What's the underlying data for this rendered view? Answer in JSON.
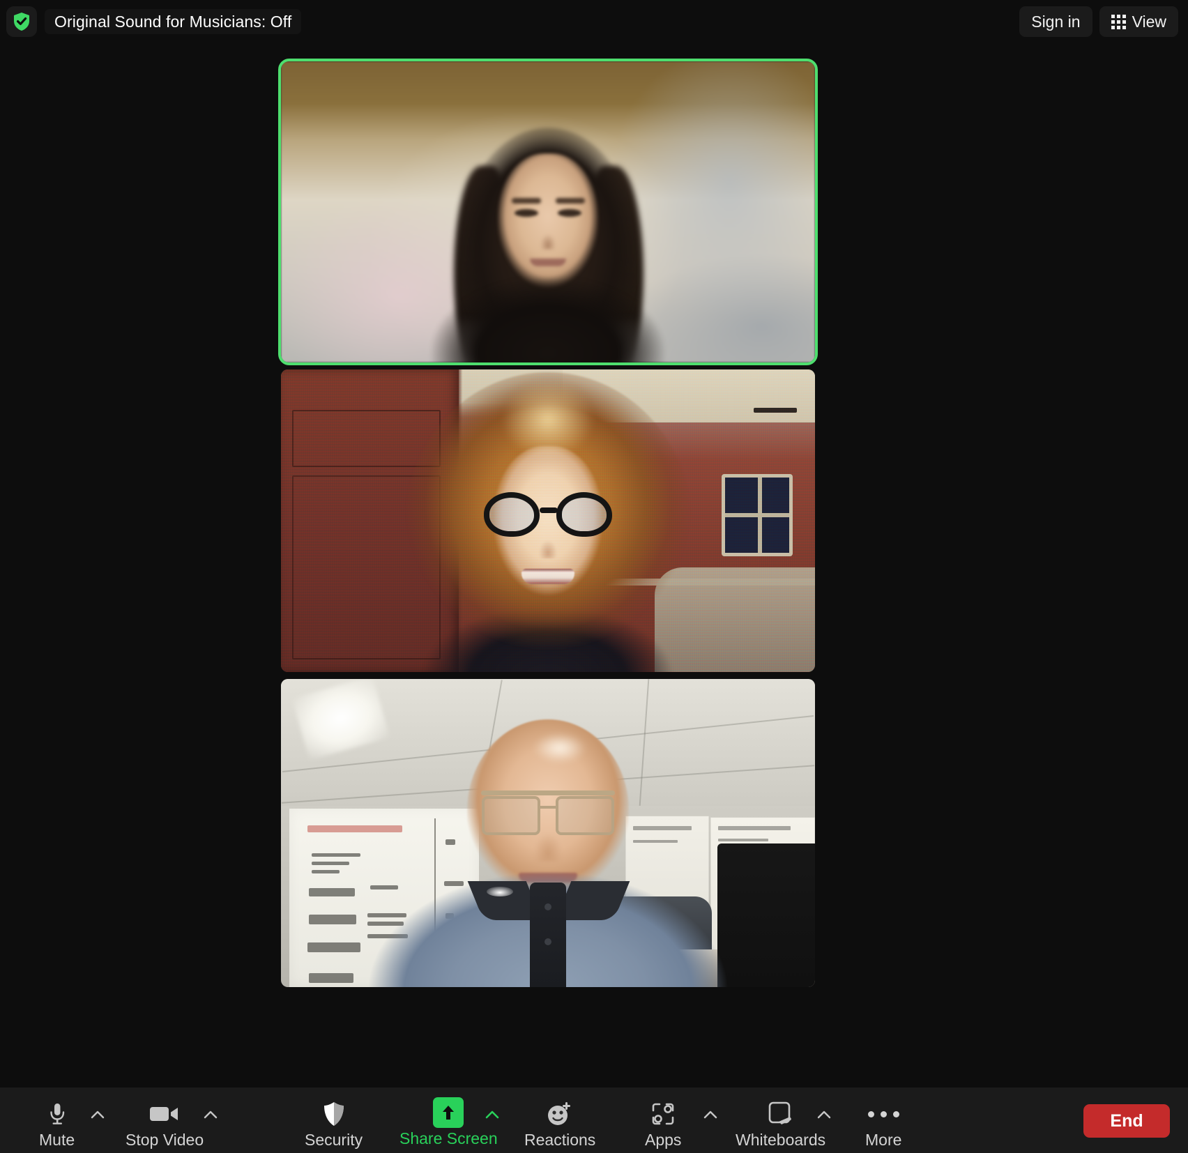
{
  "window": {
    "app": "Zoom Meeting",
    "background_color": "#0d0d0d",
    "toolbar_color": "#1b1b1b"
  },
  "topbar": {
    "security_badge_icon": "shield-check-icon",
    "security_badge_color": "#3fd964",
    "original_sound_label": "Original Sound for Musicians: Off",
    "sign_in_label": "Sign in",
    "view_label": "View",
    "view_icon": "grid-icon"
  },
  "stage": {
    "layout": "speaker-strip",
    "active_speaker_border_color": "#4ede6e",
    "participants": [
      {
        "index": 1,
        "tile_name": "participant-tile-1",
        "active_speaker": true,
        "video_on": true,
        "description": "Woman with long dark hair, blurred living-room background"
      },
      {
        "index": 2,
        "tile_name": "participant-tile-2",
        "active_speaker": false,
        "video_on": true,
        "description": "Woman with curly auburn hair and black glasses, warm red-toned room, grainy low-light video"
      },
      {
        "index": 3,
        "tile_name": "participant-tile-3",
        "active_speaker": false,
        "video_on": true,
        "description": "Bald man with gold-rimmed glasses in a blue polo shirt, classroom with whiteboard and posters"
      }
    ]
  },
  "toolbar": {
    "items": [
      {
        "id": "mute",
        "label": "Mute",
        "icon": "microphone-icon",
        "has_caret": true,
        "active": false
      },
      {
        "id": "stop-video",
        "label": "Stop Video",
        "icon": "video-camera-icon",
        "has_caret": true,
        "active": false
      },
      {
        "id": "security",
        "label": "Security",
        "icon": "shield-icon",
        "has_caret": false,
        "active": false
      },
      {
        "id": "share-screen",
        "label": "Share Screen",
        "icon": "share-arrow-icon",
        "has_caret": true,
        "active": true
      },
      {
        "id": "reactions",
        "label": "Reactions",
        "icon": "smiley-plus-icon",
        "has_caret": false,
        "active": false
      },
      {
        "id": "apps",
        "label": "Apps",
        "icon": "apps-icon",
        "has_caret": true,
        "active": false
      },
      {
        "id": "whiteboards",
        "label": "Whiteboards",
        "icon": "whiteboard-icon",
        "has_caret": true,
        "active": false
      },
      {
        "id": "more",
        "label": "More",
        "icon": "ellipsis-icon",
        "has_caret": false,
        "active": false
      }
    ],
    "end_label": "End",
    "end_color": "#c42b2b",
    "accent_green": "#29d15a"
  }
}
